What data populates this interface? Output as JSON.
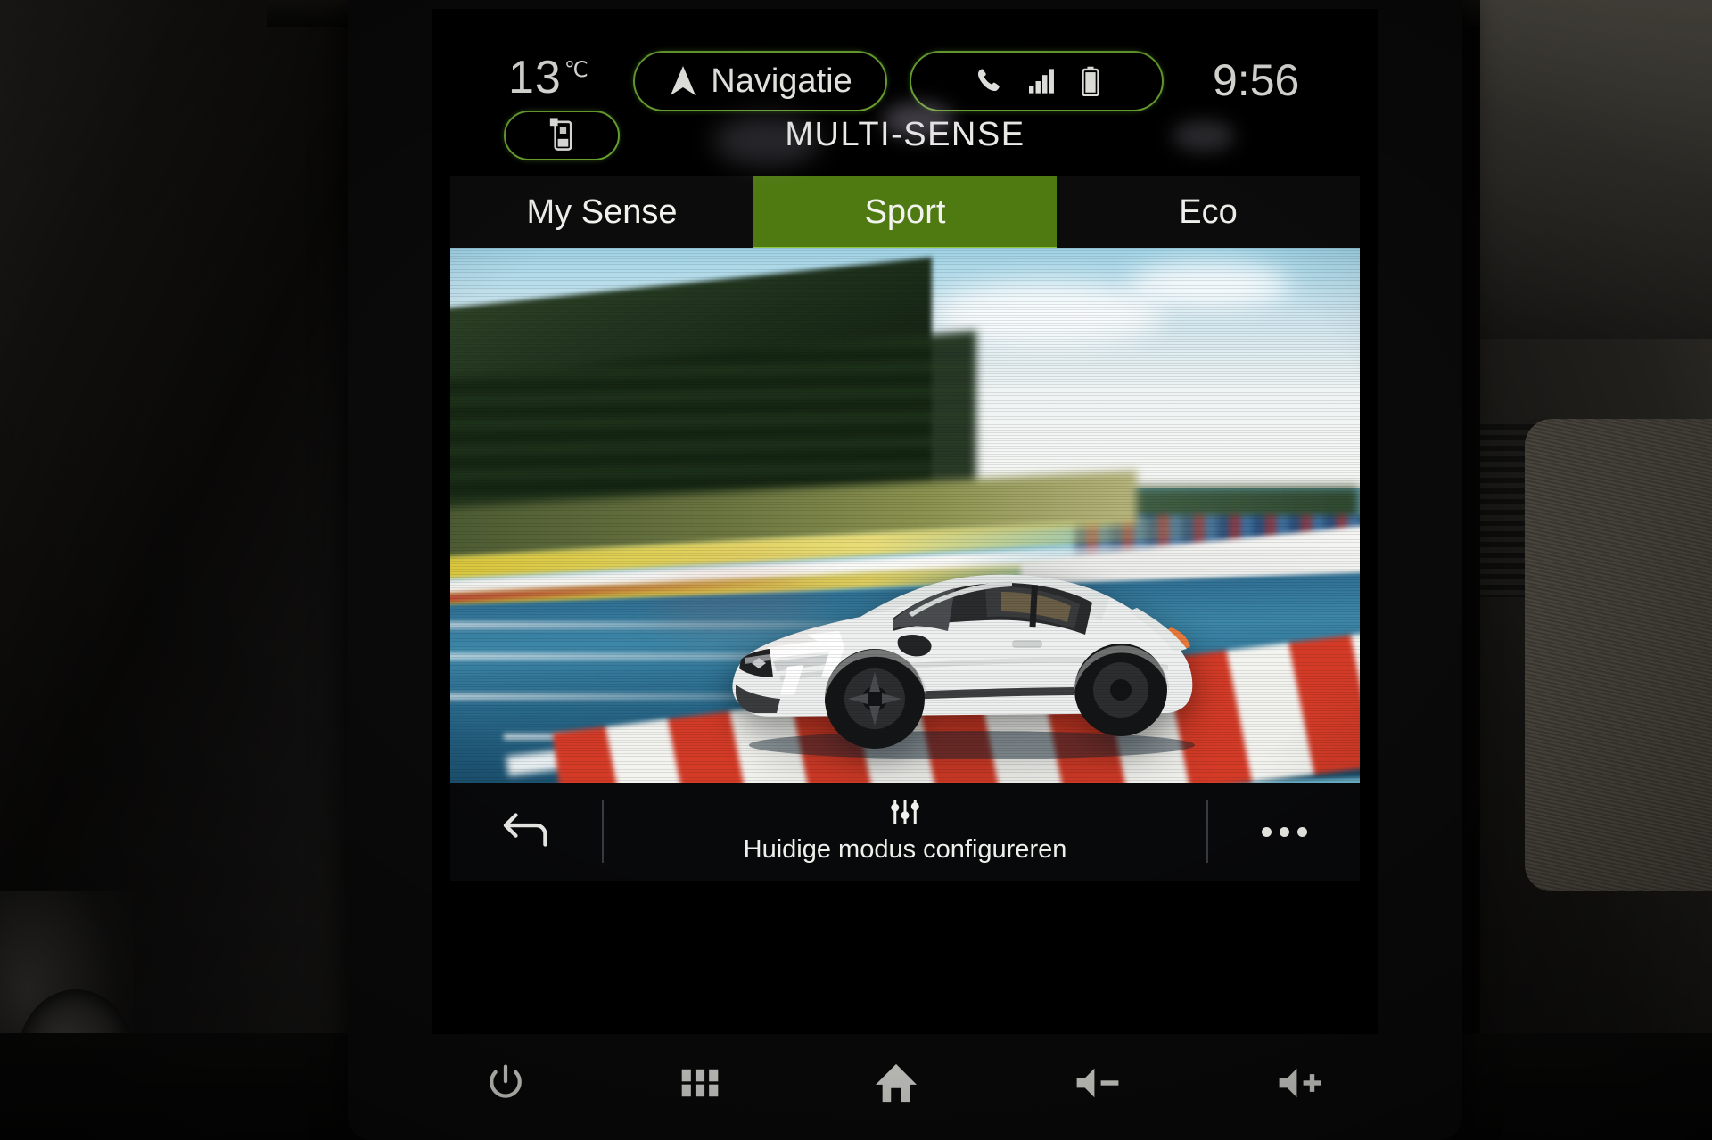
{
  "status_bar": {
    "temperature": "13",
    "temperature_unit": "℃",
    "nav_button_label": "Navigatie",
    "nav_icon": "navigation-arrow-icon",
    "phone_icon": "phone-handset-icon",
    "signal_icon": "signal-bars-icon",
    "battery_icon": "battery-icon",
    "clock": "9:56"
  },
  "header": {
    "smartphone_pill_icon": "smartphone-icon",
    "title": "MULTI-SENSE"
  },
  "tabs": [
    {
      "label": "My Sense",
      "active": false
    },
    {
      "label": "Sport",
      "active": true
    },
    {
      "label": "Eco",
      "active": false
    }
  ],
  "hero": {
    "alt": "White Renault Clio driving on a race track with motion blur"
  },
  "action_bar": {
    "back_icon": "back-arrow-icon",
    "configure_icon": "sliders-icon",
    "configure_label": "Huidige modus configureren",
    "more_icon": "more-options-icon"
  },
  "hardware_buttons": [
    {
      "name": "power",
      "icon": "power-icon"
    },
    {
      "name": "apps",
      "icon": "grid-apps-icon"
    },
    {
      "name": "home",
      "icon": "home-icon"
    },
    {
      "name": "volume-down",
      "icon": "volume-down-icon"
    },
    {
      "name": "volume-up",
      "icon": "volume-up-icon"
    }
  ],
  "colors": {
    "accent_green": "#8dc63f",
    "tab_active_bg": "#4f7a12",
    "pill_border": "#6ea832",
    "text": "#f2f2ee",
    "screen_bg": "#000000"
  }
}
